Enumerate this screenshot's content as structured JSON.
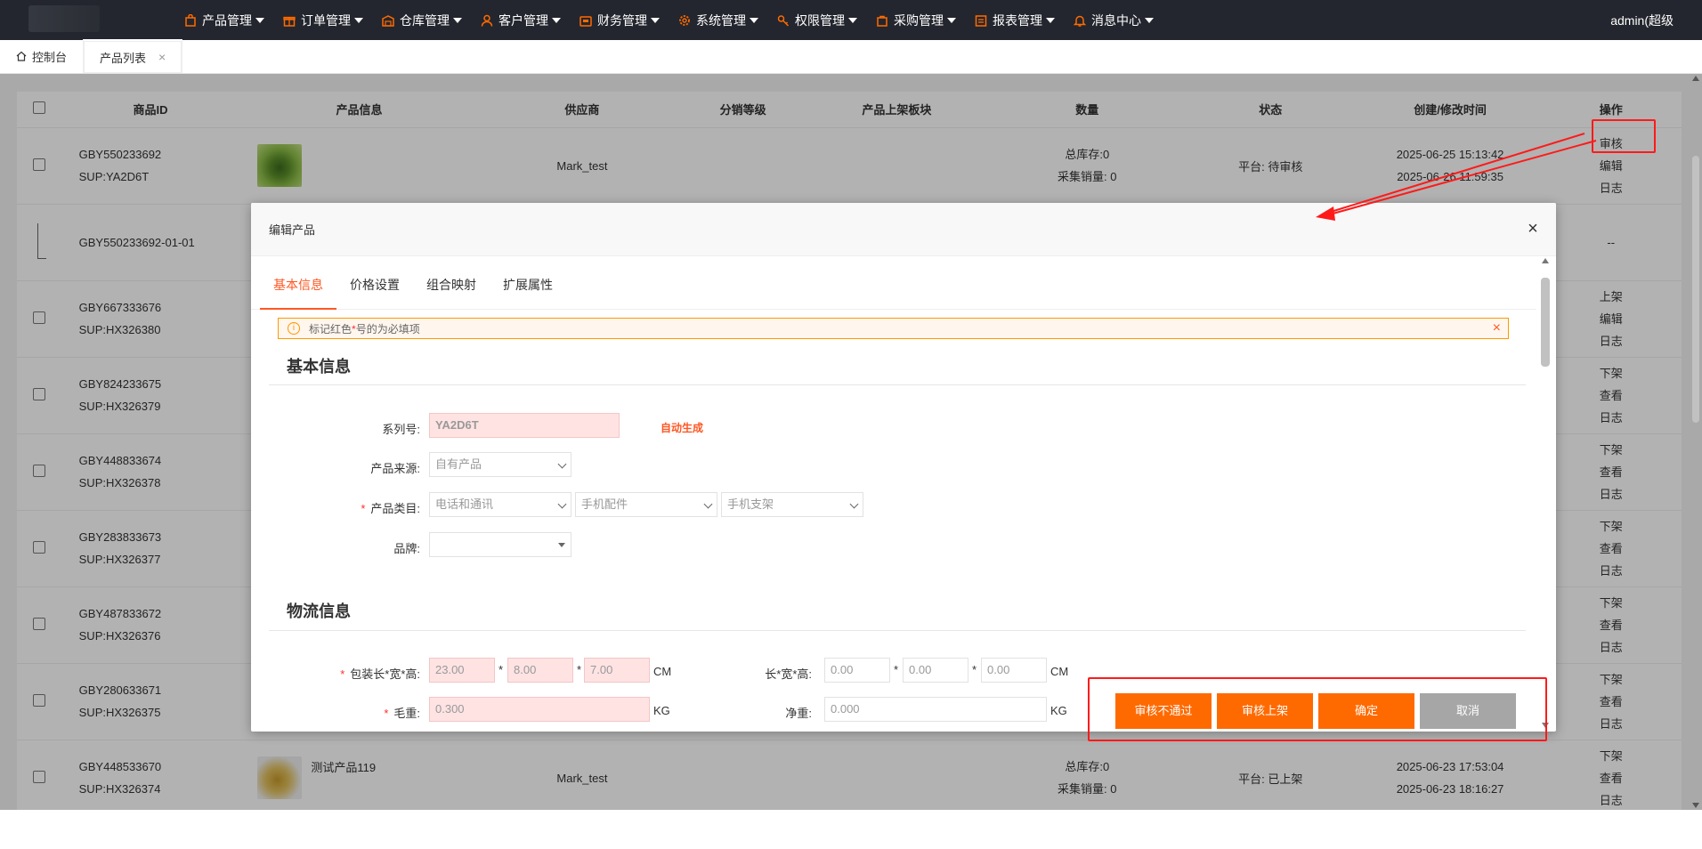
{
  "nav": {
    "menus": [
      {
        "label": "产品管理",
        "icon": "shopping-bag-icon"
      },
      {
        "label": "订单管理",
        "icon": "gift-icon"
      },
      {
        "label": "仓库管理",
        "icon": "warehouse-icon"
      },
      {
        "label": "客户管理",
        "icon": "user-icon"
      },
      {
        "label": "财务管理",
        "icon": "wallet-icon"
      },
      {
        "label": "系统管理",
        "icon": "gear-icon"
      },
      {
        "label": "权限管理",
        "icon": "key-icon"
      },
      {
        "label": "采购管理",
        "icon": "cart-icon"
      },
      {
        "label": "报表管理",
        "icon": "report-icon"
      },
      {
        "label": "消息中心",
        "icon": "bell-icon"
      }
    ],
    "user": "admin(超级"
  },
  "tabs": {
    "home": "控制台",
    "product_list": "产品列表",
    "close": "×"
  },
  "table": {
    "headers": [
      "商品ID",
      "产品信息",
      "供应商",
      "分销等级",
      "产品上架板块",
      "数量",
      "状态",
      "创建/修改时间",
      "操作"
    ],
    "rows": [
      {
        "id": "GBY550233692",
        "sup": "SUP:YA2D6T",
        "name": "",
        "supplier": "Mark_test",
        "qty1": "总库存:0",
        "qty2": "采集销量: 0",
        "status": "平台: 待审核",
        "created": "2025-06-25 15:13:42",
        "modified": "2025-06-26 11:59:35",
        "ops": [
          "审核",
          "编辑",
          "日志"
        ]
      },
      {
        "id": "GBY550233692-01-01",
        "ops": [
          "--"
        ]
      },
      {
        "id": "GBY667333676",
        "sup": "SUP:HX326380",
        "ops": [
          "上架",
          "编辑",
          "日志"
        ]
      },
      {
        "id": "GBY824233675",
        "sup": "SUP:HX326379",
        "ops": [
          "下架",
          "查看",
          "日志"
        ]
      },
      {
        "id": "GBY448833674",
        "sup": "SUP:HX326378",
        "ops": [
          "下架",
          "查看",
          "日志"
        ]
      },
      {
        "id": "GBY283833673",
        "sup": "SUP:HX326377",
        "ops": [
          "下架",
          "查看",
          "日志"
        ]
      },
      {
        "id": "GBY487833672",
        "sup": "SUP:HX326376",
        "ops": [
          "下架",
          "查看",
          "日志"
        ]
      },
      {
        "id": "GBY280633671",
        "sup": "SUP:HX326375",
        "ops": [
          "下架",
          "查看",
          "日志"
        ]
      },
      {
        "id": "GBY448533670",
        "sup": "SUP:HX326374",
        "name": "测试产品119",
        "supplier": "Mark_test",
        "qty1": "总库存:0",
        "qty2": "采集销量: 0",
        "status": "平台: 已上架",
        "created": "2025-06-23 17:53:04",
        "modified": "2025-06-23 18:16:27",
        "ops": [
          "下架",
          "查看",
          "日志"
        ]
      }
    ]
  },
  "modal": {
    "title": "编辑产品",
    "close": "×",
    "tabs": [
      "基本信息",
      "价格设置",
      "组合映射",
      "扩展属性"
    ],
    "notice": {
      "before": "标记红色",
      "star": "*",
      "after": "号的为必填项",
      "info": "i",
      "close": "×"
    },
    "basic_title": "基本信息",
    "serial_label": "系列号:",
    "serial_value": "YA2D6T",
    "autogen": "自动生成",
    "source_label": "产品来源:",
    "source_value": "自有产品",
    "category_label": "产品类目:",
    "category": [
      "电话和通讯",
      "手机配件",
      "手机支架"
    ],
    "brand_label": "品牌:",
    "brand_value": "",
    "logistics_title": "物流信息",
    "pkg_label": "包装长*宽*高:",
    "pkg": [
      "23.00",
      "8.00",
      "7.00"
    ],
    "size_label": "长*宽*高:",
    "size": [
      "0.00",
      "0.00",
      "0.00"
    ],
    "sep": "*",
    "unit_cm": "CM",
    "gross_label": "毛重:",
    "gross": "0.300",
    "net_label": "净重:",
    "net": "0.000",
    "unit_kg": "KG",
    "req": "*",
    "buttons": {
      "reject": "审核不通过",
      "approve": "审核上架",
      "confirm": "确定",
      "cancel": "取消"
    }
  }
}
